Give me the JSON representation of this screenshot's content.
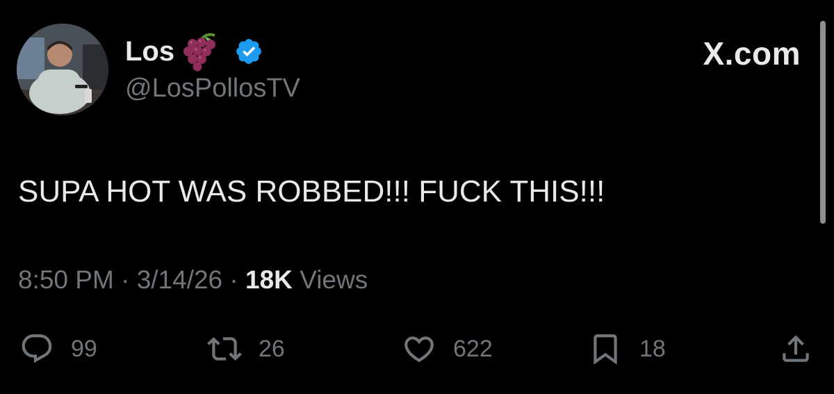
{
  "author": {
    "display_name": "Los",
    "handle": "@LosPollosTV",
    "emoji_icon": "grapes-icon",
    "verified_icon": "verified-badge-icon"
  },
  "brand": {
    "label": "X.com"
  },
  "tweet": {
    "text": "SUPA HOT WAS ROBBED!!! FUCK THIS!!!"
  },
  "meta": {
    "time": "8:50 PM",
    "separator": "·",
    "date": "3/14/26",
    "views_count": "18K",
    "views_label": "Views"
  },
  "actions": {
    "reply": {
      "icon": "reply-icon",
      "count": "99"
    },
    "repost": {
      "icon": "repost-icon",
      "count": "26"
    },
    "like": {
      "icon": "heart-icon",
      "count": "622"
    },
    "bookmark": {
      "icon": "bookmark-icon",
      "count": "18"
    },
    "share": {
      "icon": "share-icon"
    }
  },
  "colors": {
    "background": "#000000",
    "primary_text": "#e7e9ea",
    "secondary_text": "#71767b",
    "verified_blue": "#1d9bf0"
  }
}
